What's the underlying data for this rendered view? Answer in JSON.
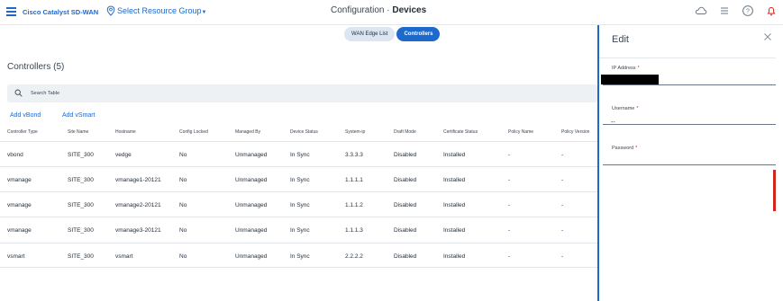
{
  "header": {
    "app_title": "Cisco Catalyst SD-WAN",
    "resource_group": "Select Resource Group",
    "page_title_prefix": "Configuration · ",
    "page_title_main": "Devices"
  },
  "tabs": [
    {
      "label": "WAN Edge List",
      "active": false
    },
    {
      "label": "Controllers",
      "active": true
    }
  ],
  "main": {
    "section_title": "Controllers (5)",
    "search_placeholder": "Search Table",
    "add_vbond": "Add vBond",
    "add_vsmart": "Add vSmart"
  },
  "table": {
    "columns": [
      "Controller Type",
      "Site Name",
      "Hostname",
      "Config Locked",
      "Managed By",
      "Device Status",
      "System-ip",
      "Draft Mode",
      "Certificate Status",
      "Policy Name",
      "Policy Version"
    ],
    "rows": [
      [
        "vbond",
        "SITE_300",
        "vedge",
        "No",
        "Unmanaged",
        "In Sync",
        "3.3.3.3",
        "Disabled",
        "Installed",
        "-",
        "-"
      ],
      [
        "vmanage",
        "SITE_300",
        "vmanage1-20121",
        "No",
        "Unmanaged",
        "In Sync",
        "1.1.1.1",
        "Disabled",
        "Installed",
        "-",
        "-"
      ],
      [
        "vmanage",
        "SITE_300",
        "vmanage2-20121",
        "No",
        "Unmanaged",
        "In Sync",
        "1.1.1.2",
        "Disabled",
        "Installed",
        "-",
        "-"
      ],
      [
        "vmanage",
        "SITE_300",
        "vmanage3-20121",
        "No",
        "Unmanaged",
        "In Sync",
        "1.1.1.3",
        "Disabled",
        "Installed",
        "-",
        "-"
      ],
      [
        "vsmart",
        "SITE_300",
        "vsmart",
        "No",
        "Unmanaged",
        "In Sync",
        "2.2.2.2",
        "Disabled",
        "Installed",
        "-",
        "-"
      ]
    ]
  },
  "edit_panel": {
    "title": "Edit",
    "ip_label": "IP Address",
    "ip_value": "",
    "username_label": "Username",
    "username_value": "--",
    "password_label": "Password",
    "password_value": "",
    "required_mark": "*"
  },
  "colors": {
    "accent": "#1d69cc",
    "alert": "#d0271d"
  },
  "icons": [
    "hamburger-icon",
    "location-pin-icon",
    "cloud-icon",
    "list-icon",
    "help-icon",
    "bell-icon",
    "search-icon",
    "close-icon"
  ]
}
